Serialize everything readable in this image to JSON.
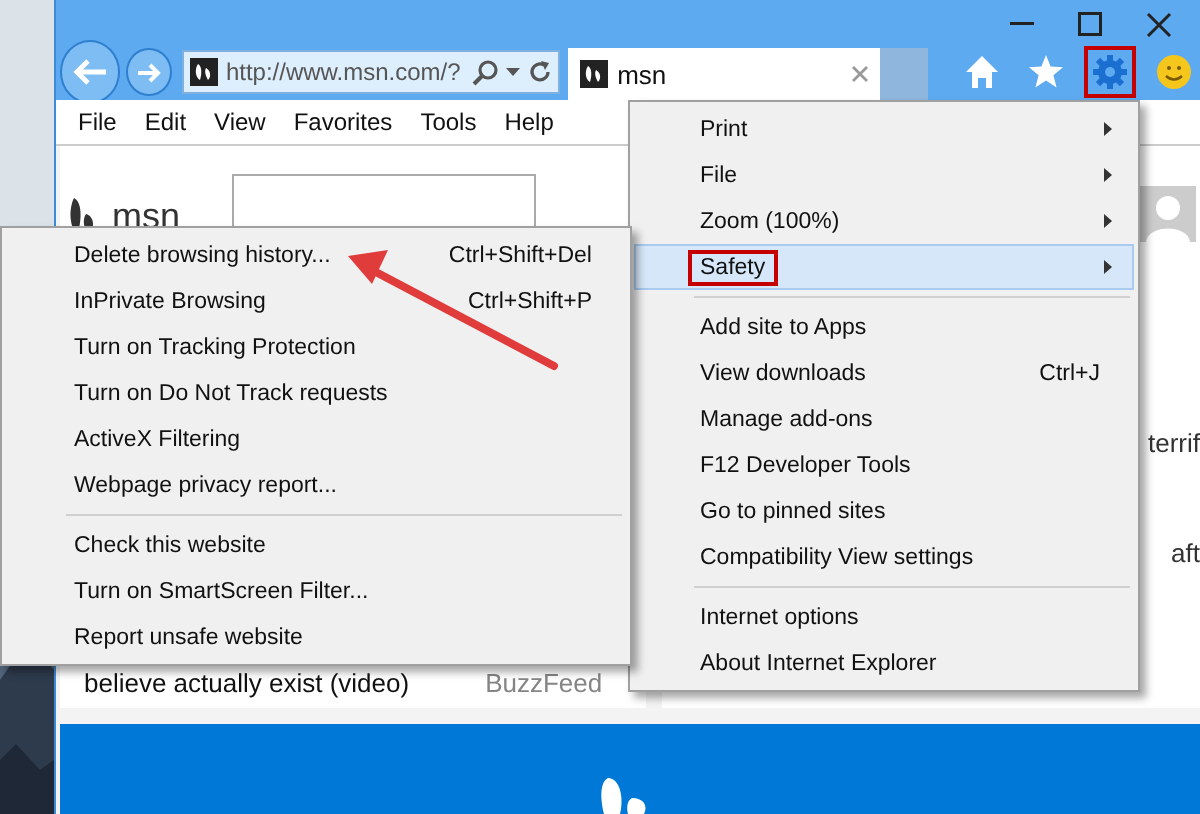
{
  "address_bar": {
    "value": "http://www.msn.com/?"
  },
  "tab": {
    "title": "msn"
  },
  "toolbar": {
    "settings_highlighted": true
  },
  "menu_bar": [
    "File",
    "Edit",
    "View",
    "Favorites",
    "Tools",
    "Help"
  ],
  "page": {
    "logo": "msn",
    "right_text_1": "terrif",
    "right_text_2": "aft",
    "headline": "believe actually exist (video)",
    "source": "BuzzFeed"
  },
  "tools_menu": [
    {
      "kind": "item",
      "label": "Print",
      "submenu": true,
      "selected": false,
      "highlighted": false
    },
    {
      "kind": "item",
      "label": "File",
      "submenu": true,
      "selected": false,
      "highlighted": false
    },
    {
      "kind": "item",
      "label": "Zoom (100%)",
      "submenu": true,
      "selected": false,
      "highlighted": false
    },
    {
      "kind": "item",
      "label": "Safety",
      "submenu": true,
      "selected": true,
      "highlighted": true
    },
    {
      "kind": "separator"
    },
    {
      "kind": "item",
      "label": "Add site to Apps",
      "submenu": false,
      "selected": false,
      "highlighted": false
    },
    {
      "kind": "item",
      "label": "View downloads",
      "shortcut": "Ctrl+J",
      "submenu": false,
      "selected": false,
      "highlighted": false
    },
    {
      "kind": "item",
      "label": "Manage add-ons",
      "submenu": false,
      "selected": false,
      "highlighted": false
    },
    {
      "kind": "item",
      "label": "F12 Developer Tools",
      "submenu": false,
      "selected": false,
      "highlighted": false
    },
    {
      "kind": "item",
      "label": "Go to pinned sites",
      "submenu": false,
      "selected": false,
      "highlighted": false
    },
    {
      "kind": "item",
      "label": "Compatibility View settings",
      "submenu": false,
      "selected": false,
      "highlighted": false
    },
    {
      "kind": "separator"
    },
    {
      "kind": "item",
      "label": "Internet options",
      "submenu": false,
      "selected": false,
      "highlighted": false
    },
    {
      "kind": "item",
      "label": "About Internet Explorer",
      "submenu": false,
      "selected": false,
      "highlighted": false
    }
  ],
  "safety_menu": [
    {
      "kind": "item",
      "label": "Delete browsing history...",
      "shortcut": "Ctrl+Shift+Del"
    },
    {
      "kind": "item",
      "label": "InPrivate Browsing",
      "shortcut": "Ctrl+Shift+P"
    },
    {
      "kind": "item",
      "label": "Turn on Tracking Protection"
    },
    {
      "kind": "item",
      "label": "Turn on Do Not Track requests"
    },
    {
      "kind": "item",
      "label": "ActiveX Filtering"
    },
    {
      "kind": "item",
      "label": "Webpage privacy report..."
    },
    {
      "kind": "separator"
    },
    {
      "kind": "item",
      "label": "Check this website"
    },
    {
      "kind": "item",
      "label": "Turn on SmartScreen Filter..."
    },
    {
      "kind": "item",
      "label": "Report unsafe website"
    }
  ]
}
